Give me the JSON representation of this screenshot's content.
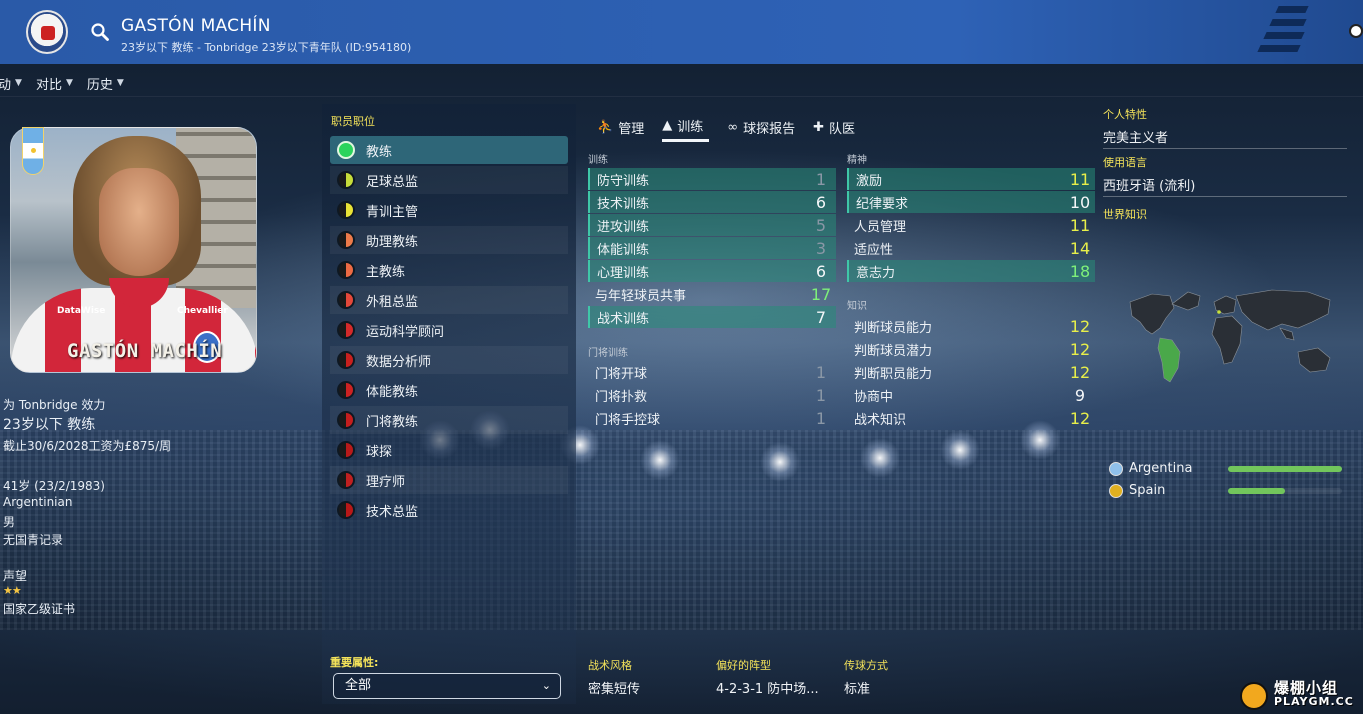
{
  "header": {
    "name": "GASTÓN MACHÍN",
    "subtitle": "23岁以下 教练 - Tonbridge 23岁以下青年队 (ID:954180)"
  },
  "nav": [
    {
      "label": "动"
    },
    {
      "label": "对比"
    },
    {
      "label": "历史"
    }
  ],
  "photo": {
    "shirt_name": "GASTÓN MACHÍN",
    "sponsor_left": "DataWise",
    "sponsor_right": "Chevallier"
  },
  "profile": {
    "plays_for": "为 Tonbridge 效力",
    "role": "23岁以下 教练",
    "contract": "截止30/6/2028工资为£875/周",
    "age": "41岁 (23/2/1983)",
    "nationality": "Argentinian",
    "gender": "男",
    "youth_record": "无国青记录",
    "reputation_label": "声望",
    "reputation_stars": 2,
    "license": "国家乙级证书"
  },
  "roles": {
    "title": "职员职位",
    "items": [
      {
        "label": "教练",
        "color": "#2bd35c",
        "active": true
      },
      {
        "label": "足球总监",
        "color": "#c6dc3a"
      },
      {
        "label": "青训主管",
        "color": "#e8e236"
      },
      {
        "label": "助理教练",
        "color": "#ec7a4a"
      },
      {
        "label": "主教练",
        "color": "#ec6a44"
      },
      {
        "label": "外租总监",
        "color": "#e4483a"
      },
      {
        "label": "运动科学顾问",
        "color": "#d42a2a"
      },
      {
        "label": "数据分析师",
        "color": "#c8201e"
      },
      {
        "label": "体能教练",
        "color": "#cc2222"
      },
      {
        "label": "门将教练",
        "color": "#c41e1e"
      },
      {
        "label": "球探",
        "color": "#b81a1a"
      },
      {
        "label": "理疗师",
        "color": "#c02020"
      },
      {
        "label": "技术总监",
        "color": "#b81818"
      }
    ]
  },
  "key_attributes": {
    "label": "重要属性:",
    "selected": "全部"
  },
  "tabs": [
    {
      "label": "管理",
      "icon": "management-icon"
    },
    {
      "label": "训练",
      "icon": "training-icon",
      "active": true
    },
    {
      "label": "球探报告",
      "icon": "binoculars-icon"
    },
    {
      "label": "队医",
      "icon": "medical-icon"
    }
  ],
  "coaching": {
    "label": "训练",
    "items": [
      {
        "label": "防守训练",
        "value": "1",
        "hl": true,
        "tone": "grey"
      },
      {
        "label": "技术训练",
        "value": "6",
        "hl": true,
        "tone": "white"
      },
      {
        "label": "进攻训练",
        "value": "5",
        "hl": true,
        "tone": "grey"
      },
      {
        "label": "体能训练",
        "value": "3",
        "hl": true,
        "tone": "grey"
      },
      {
        "label": "心理训练",
        "value": "6",
        "hl": true,
        "tone": "white"
      },
      {
        "label": "与年轻球员共事",
        "value": "17",
        "hl": false,
        "tone": "green"
      },
      {
        "label": "战术训练",
        "value": "7",
        "hl": true,
        "tone": "white"
      }
    ]
  },
  "goalkeeping": {
    "label": "门将训练",
    "items": [
      {
        "label": "门将开球",
        "value": "1",
        "tone": "grey"
      },
      {
        "label": "门将扑救",
        "value": "1",
        "tone": "grey"
      },
      {
        "label": "门将手控球",
        "value": "1",
        "tone": "grey"
      }
    ]
  },
  "mental": {
    "label": "精神",
    "items": [
      {
        "label": "激励",
        "value": "11",
        "hl": true,
        "tone": "yellow"
      },
      {
        "label": "纪律要求",
        "value": "10",
        "hl": true,
        "tone": "white"
      },
      {
        "label": "人员管理",
        "value": "11",
        "hl": false,
        "tone": "yellow"
      },
      {
        "label": "适应性",
        "value": "14",
        "hl": false,
        "tone": "yellow"
      },
      {
        "label": "意志力",
        "value": "18",
        "hl": true,
        "tone": "green"
      }
    ]
  },
  "knowledge": {
    "label": "知识",
    "items": [
      {
        "label": "判断球员能力",
        "value": "12",
        "tone": "yellow"
      },
      {
        "label": "判断球员潜力",
        "value": "12",
        "tone": "yellow"
      },
      {
        "label": "判断职员能力",
        "value": "12",
        "tone": "yellow"
      },
      {
        "label": "协商中",
        "value": "9",
        "tone": "white"
      },
      {
        "label": "战术知识",
        "value": "12",
        "tone": "yellow"
      }
    ]
  },
  "personal": {
    "trait_label": "个人特性",
    "trait_value": "完美主义者",
    "language_label": "使用语言",
    "language_value": "西班牙语 (流利)",
    "world_label": "世界知识"
  },
  "nations": [
    {
      "name": "Argentina",
      "level": 1.0,
      "flag_color": "#8fc0ea"
    },
    {
      "name": "Spain",
      "level": 0.5,
      "flag_color": "#e0b020"
    }
  ],
  "tactics": [
    {
      "label": "战术风格",
      "value": "密集短传"
    },
    {
      "label": "偏好的阵型",
      "value": "4-2-3-1 防中场..."
    },
    {
      "label": "传球方式",
      "value": "标准"
    }
  ],
  "watermark": {
    "line1": "爆棚小组",
    "line2": "PLAYGM.CC"
  }
}
